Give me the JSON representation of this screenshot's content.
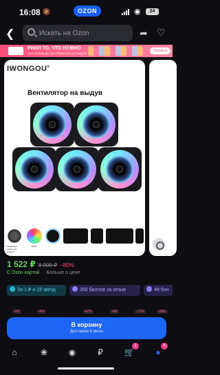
{
  "status_bar": {
    "time": "16:08",
    "logo": "OZON",
    "battery": "24"
  },
  "search": {
    "placeholder": "Искать на Ozon"
  },
  "promo_banner": {
    "headline": "РИИЛ ТО, ЧТО НУЖНО",
    "subline": "РАЗГОНЯЕМ ДО ЭКСТРЕМАЛЬНЫХ СКИДОК",
    "button": "Перейти"
  },
  "product": {
    "brand": "IWONGOU",
    "image_title": "Вентилятор на выдув",
    "fan_count": 5,
    "logo_captions": [
      "Резиновые ножки для тишины",
      "ARGB"
    ]
  },
  "price": {
    "current": "1 522 ₽",
    "old": "8 000 ₽",
    "discount": "−80%",
    "card_label": "С Ozon картой",
    "more_price": "Больше о цене"
  },
  "chips": [
    {
      "label": "За 1 ₽ и 19 звёзд",
      "icon": "star-icon",
      "color": "#25b9d6"
    },
    {
      "label": "350 баллов за отзыв",
      "icon": "points-icon",
      "color": "#8b7cff"
    },
    {
      "label": "48 бон",
      "icon": "bonus-icon",
      "color": "#8b7cff"
    }
  ],
  "discount_strip": [
    "-4%",
    "-4%",
    "-40%",
    "-4%",
    "-17%",
    "-38%"
  ],
  "cart": {
    "label": "В корзину",
    "sublabel": "Доставим 6 июня"
  },
  "tab_bar": {
    "items": [
      {
        "name": "home",
        "icon": "home-icon"
      },
      {
        "name": "fresh",
        "icon": "leaf-icon"
      },
      {
        "name": "ozon",
        "icon": "ozon-icon"
      },
      {
        "name": "finance",
        "icon": "ruble-icon"
      },
      {
        "name": "cart",
        "icon": "cart-icon",
        "badge": "1"
      },
      {
        "name": "profile",
        "icon": "profile-icon",
        "badge": "4"
      }
    ]
  },
  "colors": {
    "accent": "#1e66f5",
    "price": "#5fd35d",
    "discount": "#ff3f6f"
  }
}
